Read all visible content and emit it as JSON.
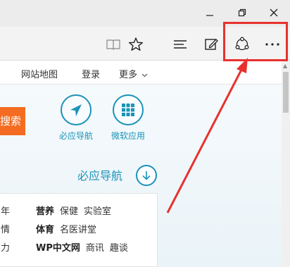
{
  "browser": {
    "icons": {
      "minimize": "minimize-icon",
      "restore": "restore-icon",
      "close": "close-icon",
      "reading_view": "reading-view-icon",
      "favorites": "favorites-star-icon",
      "hub": "hub-icon",
      "web_note": "web-note-icon",
      "share": "share-icon",
      "more": "more-actions-icon"
    },
    "highlight_color": "#e8312f"
  },
  "site_nav": {
    "links": [
      "网站地图",
      "登录",
      "更多"
    ]
  },
  "search_button_label": "搜索",
  "apps": [
    {
      "label": "必应导航",
      "icon": "navigation-arrow-icon"
    },
    {
      "label": "微软应用",
      "icon": "app-grid-icon"
    }
  ],
  "section": {
    "title": "必应导航",
    "icon": "down-arrow-circle-icon"
  },
  "links_panel": {
    "left_fragments": [
      "年",
      "情",
      "力"
    ],
    "rows": [
      {
        "category": "营养",
        "items": [
          "保健",
          "实验室"
        ]
      },
      {
        "category": "体育",
        "items": [
          "名医讲堂"
        ]
      },
      {
        "category": "WP中文网",
        "items": [
          "商讯",
          "趣谈"
        ]
      }
    ]
  },
  "accent_color": "#1a93b8",
  "orange_color": "#f36c21"
}
